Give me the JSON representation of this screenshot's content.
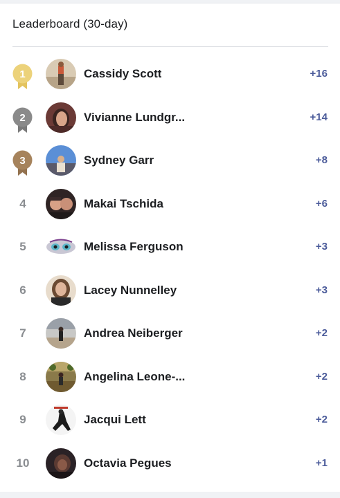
{
  "leaderboard": {
    "title": "Leaderboard (30-day)",
    "entries": [
      {
        "rank": "1",
        "name": "Cassidy Scott",
        "score": "+16",
        "medal": "gold"
      },
      {
        "rank": "2",
        "name": "Vivianne Lundgr...",
        "score": "+14",
        "medal": "silver"
      },
      {
        "rank": "3",
        "name": "Sydney Garr",
        "score": "+8",
        "medal": "bronze"
      },
      {
        "rank": "4",
        "name": "Makai Tschida",
        "score": "+6",
        "medal": ""
      },
      {
        "rank": "5",
        "name": "Melissa Ferguson",
        "score": "+3",
        "medal": ""
      },
      {
        "rank": "6",
        "name": "Lacey Nunnelley",
        "score": "+3",
        "medal": ""
      },
      {
        "rank": "7",
        "name": "Andrea Neiberger",
        "score": "+2",
        "medal": ""
      },
      {
        "rank": "8",
        "name": "Angelina Leone-...",
        "score": "+2",
        "medal": ""
      },
      {
        "rank": "9",
        "name": "Jacqui Lett",
        "score": "+2",
        "medal": ""
      },
      {
        "rank": "10",
        "name": "Octavia Pegues",
        "score": "+1",
        "medal": ""
      }
    ]
  },
  "colors": {
    "gold": "#ecd27a",
    "silver": "#8a8a8a",
    "bronze": "#a6835c",
    "score": "#4b5b9a"
  }
}
